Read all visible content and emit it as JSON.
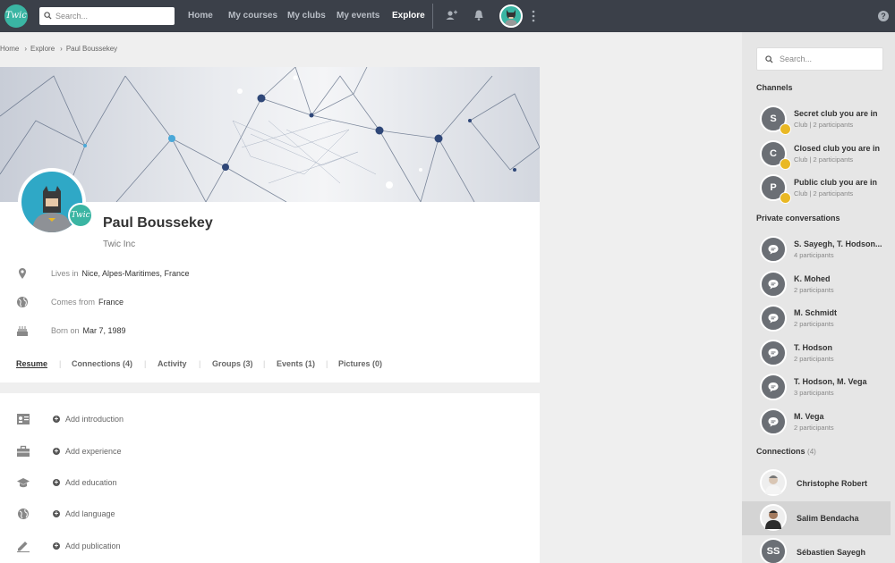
{
  "topbar": {
    "logo_text": "Twic",
    "search_placeholder": "Search...",
    "nav": [
      {
        "label": "Home",
        "active": false
      },
      {
        "label": "My courses",
        "active": false
      },
      {
        "label": "My clubs",
        "active": false
      },
      {
        "label": "My events",
        "active": false
      },
      {
        "label": "Explore",
        "active": true
      }
    ],
    "icons": [
      "add-person-icon",
      "bell-icon",
      "user-avatar",
      "more-vert-icon",
      "help-icon"
    ],
    "help_text": "?"
  },
  "breadcrumb": [
    "Home",
    "Explore",
    "Paul Boussekey"
  ],
  "profile": {
    "name": "Paul Boussekey",
    "company": "Twic Inc",
    "badge_text": "Twic",
    "info": [
      {
        "icon": "location-pin-icon",
        "label": "Lives in",
        "value": "Nice, Alpes-Maritimes, France"
      },
      {
        "icon": "globe-icon",
        "label": "Comes from",
        "value": "France"
      },
      {
        "icon": "birthday-cake-icon",
        "label": "Born on",
        "value": "Mar 7, 1989"
      }
    ],
    "tabs": [
      {
        "label": "Resume",
        "active": true
      },
      {
        "label": "Connections (4)",
        "active": false
      },
      {
        "label": "Activity",
        "active": false
      },
      {
        "label": "Groups (3)",
        "active": false
      },
      {
        "label": "Events (1)",
        "active": false
      },
      {
        "label": "Pictures (0)",
        "active": false
      }
    ]
  },
  "resume": {
    "items": [
      {
        "icon": "id-card-icon",
        "label": "Add introduction"
      },
      {
        "icon": "briefcase-icon",
        "label": "Add experience"
      },
      {
        "icon": "graduation-cap-icon",
        "label": "Add education"
      },
      {
        "icon": "globe-icon",
        "label": "Add language"
      },
      {
        "icon": "pencil-icon",
        "label": "Add publication"
      }
    ]
  },
  "sidebar": {
    "search_placeholder": "Search...",
    "channels_title": "Channels",
    "channels": [
      {
        "initial": "S",
        "name": "Secret club you are in",
        "sub": "Club | 2 participants"
      },
      {
        "initial": "C",
        "name": "Closed club you are in",
        "sub": "Club | 2 participants"
      },
      {
        "initial": "P",
        "name": "Public club you are in",
        "sub": "Club | 2 participants"
      }
    ],
    "private_title": "Private conversations",
    "conversations": [
      {
        "name": "S. Sayegh, T. Hodson...",
        "sub": "4 participants"
      },
      {
        "name": "K. Mohed",
        "sub": "2 participants"
      },
      {
        "name": "M. Schmidt",
        "sub": "2 participants"
      },
      {
        "name": "T. Hodson",
        "sub": "2 participants"
      },
      {
        "name": "T. Hodson, M. Vega",
        "sub": "3 participants"
      },
      {
        "name": "M. Vega",
        "sub": "2 participants"
      }
    ],
    "connections_title": "Connections",
    "connections_count": "(4)",
    "connections": [
      {
        "name": "Christophe Robert",
        "initials": "",
        "highlight": false
      },
      {
        "name": "Salim Bendacha",
        "initials": "",
        "highlight": true
      },
      {
        "name": "Sébastien Sayegh",
        "initials": "SS",
        "highlight": false
      }
    ]
  },
  "colors": {
    "topbar": "#3b4049",
    "accent": "#3ab5a3",
    "club_badge": "#e9b824",
    "sidebar": "#e6e6e6"
  }
}
